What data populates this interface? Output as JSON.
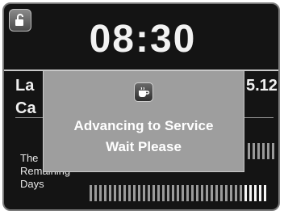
{
  "clock": {
    "time": "08:30"
  },
  "rows": [
    {
      "label": "La",
      "value": "5.12"
    },
    {
      "label": "Ca"
    }
  ],
  "remaining": {
    "label_lines": [
      "The",
      "Remaining",
      "Days"
    ]
  },
  "dialog": {
    "line1": "Advancing to Service",
    "line2": "Wait Please",
    "icon": "coffee-cup-icon"
  },
  "icons": {
    "lock": "unlock-icon"
  },
  "colors": {
    "screen_bg": "#141414",
    "dialog_bg": "#9e9e9e",
    "text": "#f0f0f0"
  }
}
